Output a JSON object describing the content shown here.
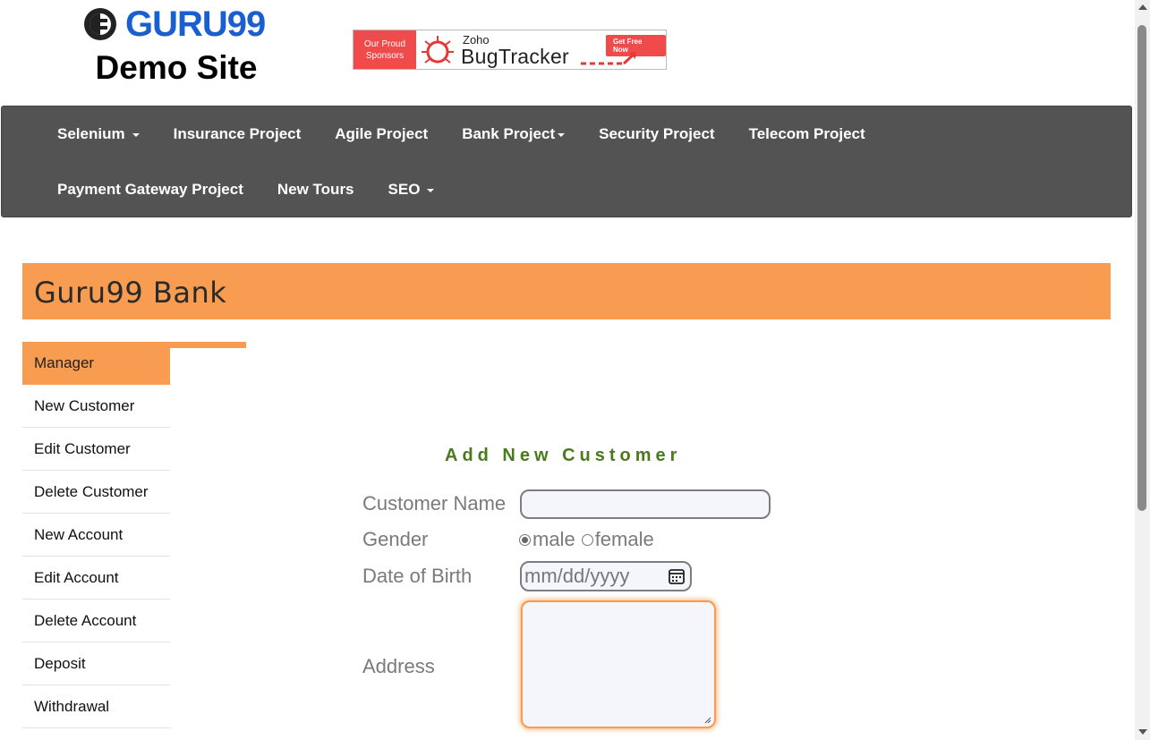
{
  "header": {
    "logo_text": "GURU99",
    "logo_subtitle": "Demo Site",
    "banner": {
      "sponsor_line1": "Our Proud",
      "sponsor_line2": "Sponsors",
      "brand": "Zoho",
      "product": "BugTracker",
      "cta": "Get Free Now"
    }
  },
  "nav": {
    "row1": [
      {
        "label": "Selenium",
        "dropdown": true
      },
      {
        "label": "Insurance Project",
        "dropdown": false
      },
      {
        "label": "Agile Project",
        "dropdown": false
      },
      {
        "label": "Bank Project",
        "dropdown": true
      },
      {
        "label": "Security Project",
        "dropdown": false
      },
      {
        "label": "Telecom Project",
        "dropdown": false
      }
    ],
    "row2": [
      {
        "label": "Payment Gateway Project",
        "dropdown": false
      },
      {
        "label": "New Tours",
        "dropdown": false
      },
      {
        "label": "SEO",
        "dropdown": true
      }
    ]
  },
  "bank": {
    "title": "Guru99 Bank"
  },
  "sidebar": {
    "items": [
      {
        "label": "Manager",
        "active": true
      },
      {
        "label": "New Customer"
      },
      {
        "label": "Edit Customer"
      },
      {
        "label": "Delete Customer"
      },
      {
        "label": "New Account"
      },
      {
        "label": "Edit Account"
      },
      {
        "label": "Delete Account"
      },
      {
        "label": "Deposit"
      },
      {
        "label": "Withdrawal"
      }
    ]
  },
  "form": {
    "title": "Add New Customer",
    "customer_name_label": "Customer Name",
    "customer_name_value": "",
    "gender_label": "Gender",
    "gender_options": [
      "male",
      "female"
    ],
    "gender_selected": "male",
    "dob_label": "Date of Birth",
    "dob_placeholder": "mm/dd/yyyy",
    "address_label": "Address",
    "address_value": ""
  },
  "colors": {
    "accent_orange": "#f79c50",
    "nav_bg": "#535353",
    "logo_blue": "#1a5fd0",
    "form_title_green": "#4a7a1c"
  }
}
